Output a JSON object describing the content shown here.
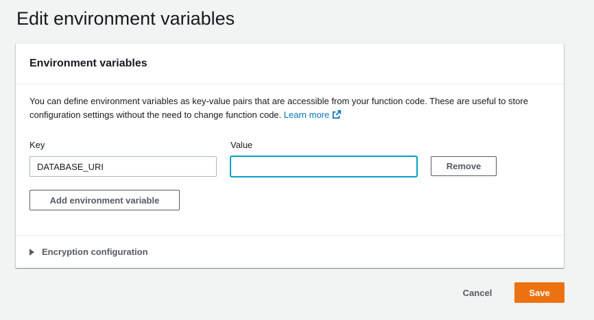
{
  "page": {
    "title": "Edit environment variables"
  },
  "panel": {
    "title": "Environment variables",
    "description": "You can define environment variables as key-value pairs that are accessible from your function code. These are useful to store configuration settings without the need to change function code.",
    "learn_more": "Learn more",
    "learn_more_icon": "external-link-icon"
  },
  "variables": [
    {
      "key_label": "Key",
      "value_label": "Value",
      "key": "DATABASE_URI",
      "value": "",
      "remove_label": "Remove"
    }
  ],
  "add_button_label": "Add environment variable",
  "encryption": {
    "label": "Encryption configuration",
    "expanded": false
  },
  "footer": {
    "cancel_label": "Cancel",
    "save_label": "Save"
  },
  "colors": {
    "accent_link": "#0073bb",
    "primary_button": "#ec7211",
    "focus_border": "#00a1c9",
    "background": "#f2f3f3"
  }
}
